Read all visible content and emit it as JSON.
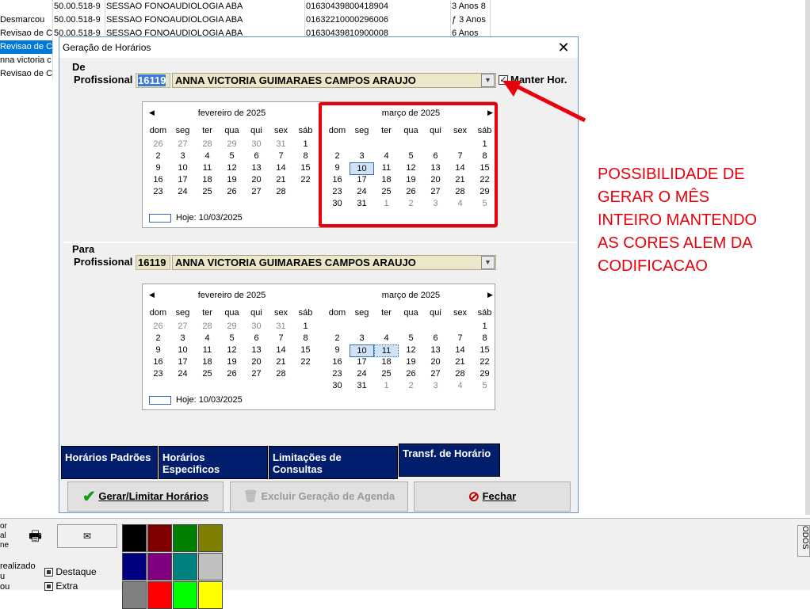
{
  "background_table": {
    "rows": [
      {
        "c0": "",
        "c1": "50.00.518-9",
        "c2": "SESSAO FONOAUDIOLOGIA ABA",
        "c3": "01630439800418904",
        "c4": "3 Anos 8"
      },
      {
        "c0": "Desmarcou",
        "c1": "50.00.518-9",
        "c2": "SESSAO FONOAUDIOLOGIA ABA",
        "c3": "01632210000296006",
        "c4": "ƒ 3 Anos"
      },
      {
        "c0": "Revisao de Co",
        "c1": "50.00.518-9",
        "c2": "SESSAO FONOAUDIOLOGIA ABA",
        "c3": "01630439810900008",
        "c4": "6 Anos"
      },
      {
        "c0": "Revisao de Co",
        "c1": "",
        "c2": "",
        "c3": "",
        "c4": ""
      },
      {
        "c0": "nna victoria c",
        "c1": "",
        "c2": "",
        "c3": "",
        "c4": ""
      },
      {
        "c0": "Revisao de Co",
        "c1": "",
        "c2": "",
        "c3": "",
        "c4": ""
      }
    ]
  },
  "dialog": {
    "title": "Geração de Horários",
    "close": "✕",
    "de": {
      "group_label": "De",
      "prof_label": "Profissional",
      "code": "16119",
      "name": "ANNA VICTORIA GUIMARAES CAMPOS ARAUJO",
      "manter_label": "Manter Hor."
    },
    "para": {
      "group_label": "Para",
      "prof_label": "Profissional",
      "code": "16119",
      "name": "ANNA VICTORIA GUIMARAES CAMPOS ARAUJO"
    },
    "calendar": {
      "dows": [
        "dom",
        "seg",
        "ter",
        "qua",
        "qui",
        "sex",
        "sáb"
      ],
      "feb_title": "fevereiro de 2025",
      "mar_title": "março de 2025",
      "feb_days": [
        "26",
        "27",
        "28",
        "29",
        "30",
        "31",
        "1",
        "2",
        "3",
        "4",
        "5",
        "6",
        "7",
        "8",
        "9",
        "10",
        "11",
        "12",
        "13",
        "14",
        "15",
        "16",
        "17",
        "18",
        "19",
        "20",
        "21",
        "22",
        "23",
        "24",
        "25",
        "26",
        "27",
        "28"
      ],
      "mar_days": [
        "",
        "",
        "",
        "",
        "",
        "",
        "1",
        "2",
        "3",
        "4",
        "5",
        "6",
        "7",
        "8",
        "9",
        "10",
        "11",
        "12",
        "13",
        "14",
        "15",
        "16",
        "17",
        "18",
        "19",
        "20",
        "21",
        "22",
        "23",
        "24",
        "25",
        "26",
        "27",
        "28",
        "29",
        "30",
        "31",
        "1",
        "2",
        "3",
        "4",
        "5"
      ],
      "today_label": "Hoje: 10/03/2025"
    },
    "tabs": [
      "Horários Padrões",
      "Horários Especificos",
      "Limitações de Consultas",
      "Transf. de Horário"
    ],
    "buttons": {
      "gerar": "Gerar/Limitar Horários",
      "excluir": "Excluir Geração de Agenda",
      "fechar": "Fechar"
    }
  },
  "annotation": {
    "lines": [
      "POSSIBILIDADE DE",
      "GERAR O MÊS",
      "INTEIRO MANTENDO",
      "AS CORES ALEM DA",
      "CODIFICACAO"
    ]
  },
  "bottom": {
    "left_text_lines": [
      "or",
      "al",
      "ne"
    ],
    "status_lines": [
      "realizado",
      "u",
      "ou"
    ],
    "destaque": "Destaque",
    "extra": "Extra",
    "right_text": "ODOS"
  },
  "colors": {
    "palette": [
      "#000000",
      "#800000",
      "#008000",
      "#808000",
      "#000080",
      "#800080",
      "#008080",
      "#c0c0c0",
      "#808080",
      "#ff0000",
      "#00ff00",
      "#ffff00"
    ],
    "accent_red": "#e8000b",
    "tab_bg": "#001e6c"
  }
}
